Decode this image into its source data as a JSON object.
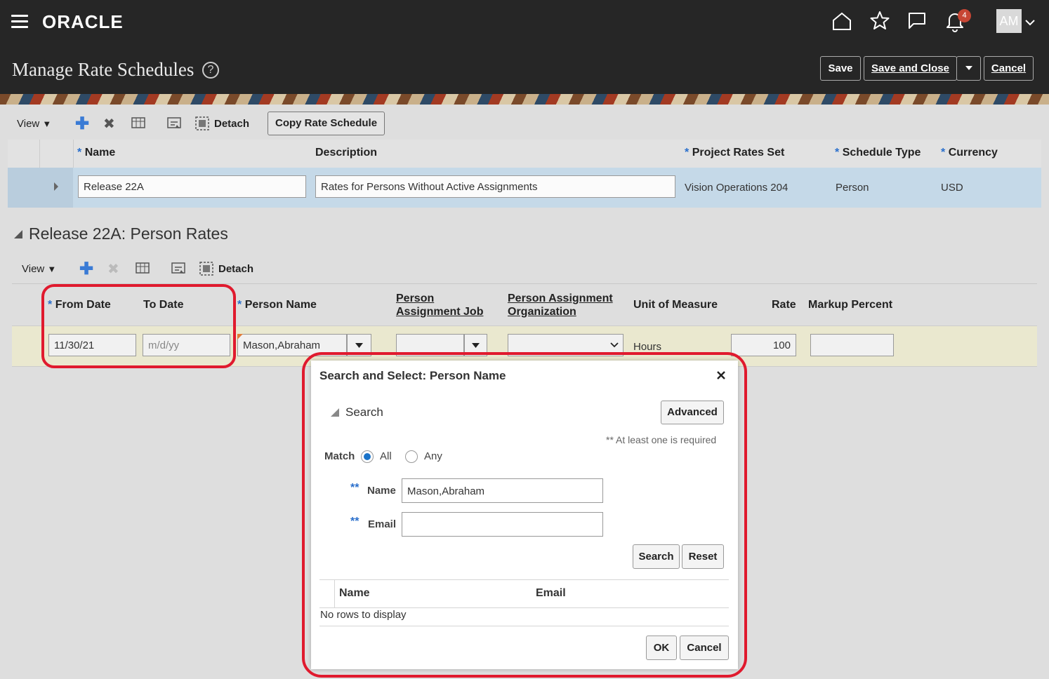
{
  "app": {
    "logo": "ORACLE",
    "page_title": "Manage Rate Schedules",
    "help_glyph": "?",
    "notif_count": "4",
    "avatar": "AM"
  },
  "header_actions": {
    "save": "Save",
    "save_close": "Save and Close",
    "cancel": "Cancel"
  },
  "toolbar": {
    "view": "View",
    "detach": "Detach",
    "copy": "Copy Rate Schedule"
  },
  "schedule_table": {
    "headers": {
      "name": "Name",
      "description": "Description",
      "rates_set": "Project Rates Set",
      "schedule_type": "Schedule Type",
      "currency": "Currency"
    },
    "row": {
      "name": "Release 22A",
      "description": "Rates for Persons Without Active Assignments",
      "rates_set": "Vision Operations 204",
      "schedule_type": "Person",
      "currency": "USD"
    }
  },
  "person_rates": {
    "title": "Release 22A: Person Rates",
    "toolbar": {
      "view": "View",
      "detach": "Detach"
    },
    "headers": {
      "from_date": "From Date",
      "to_date": "To Date",
      "person_name": "Person Name",
      "job_line1": "Person",
      "job_line2": "Assignment Job",
      "org_line1": "Person Assignment",
      "org_line2": "Organization",
      "uom": "Unit of Measure",
      "rate": "Rate",
      "markup": "Markup Percent"
    },
    "row": {
      "from_date": "11/30/21",
      "to_date_placeholder": "m/d/yy",
      "person_name": "Mason,Abraham",
      "uom": "Hours",
      "rate": "100"
    }
  },
  "dialog": {
    "title": "Search and Select: Person Name",
    "search_section": "Search",
    "advanced": "Advanced",
    "required_note": "** At least one is required",
    "match_label": "Match",
    "match_all": "All",
    "match_any": "Any",
    "req_marker": "**",
    "name_label": "Name",
    "name_value": "Mason,Abraham",
    "email_label": "Email",
    "email_value": "",
    "search_btn": "Search",
    "reset_btn": "Reset",
    "col_name": "Name",
    "col_email": "Email",
    "empty": "No rows to display",
    "ok": "OK",
    "cancel": "Cancel"
  },
  "colors": {
    "accent": "#1a73c9",
    "highlight": "#e01a2e",
    "topbar": "#262626",
    "row_selected": "#c5d9e8",
    "row_active": "#eae8cf"
  }
}
